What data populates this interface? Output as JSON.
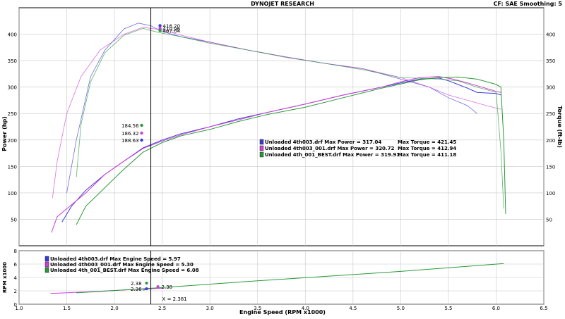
{
  "header": {
    "title": "DYNOJET RESEARCH",
    "settings": "CF: SAE  Smoothing: 5"
  },
  "colors": {
    "run1": "#3b3bd6",
    "run2": "#d040d8",
    "run3": "#2a9a38",
    "axis": "#000000",
    "grid": "#c8c8c8"
  },
  "chart_data": [
    {
      "type": "line",
      "title": "",
      "xlabel": "Engine Speed (RPM x1000)",
      "ylabel": "Power (hp)",
      "ylabel_right": "Torque (ft-lb)",
      "xlim": [
        1.0,
        6.5
      ],
      "ylim": [
        0,
        450
      ],
      "x_ticks": [
        "1.0",
        "1.5",
        "2.0",
        "2.5",
        "3.0",
        "3.5",
        "4.0",
        "4.5",
        "5.0",
        "5.5",
        "6.0",
        "6.5"
      ],
      "y_ticks": [
        "50",
        "100",
        "150",
        "200",
        "250",
        "300",
        "350",
        "400"
      ],
      "grid": true,
      "cursor_x": 2.381,
      "legend": [
        {
          "label": "Unloaded 4th003.drf Max Power = 317.04",
          "torque": "Max Torque = 421.45"
        },
        {
          "label": "Unloaded 4th003_001.drf Max Power = 320.72",
          "torque": "Max Torque = 412.94"
        },
        {
          "label": "Unloaded 4th_001_BEST.drf Max Power = 319.91",
          "torque": "Max Torque = 411.18"
        }
      ],
      "torque_cursor_labels": [
        "416.20",
        "410.96",
        "407.04"
      ],
      "power_cursor_labels": [
        "188.63",
        "186.32",
        "184.56"
      ],
      "series": [
        {
          "name": "4th003 Power",
          "x": [
            1.45,
            1.55,
            1.7,
            1.9,
            2.1,
            2.3,
            2.5,
            2.7,
            3.0,
            3.3,
            3.6,
            4.0,
            4.4,
            4.8,
            5.0,
            5.2,
            5.4,
            5.5,
            5.6,
            5.7,
            5.8,
            6.0,
            6.05
          ],
          "y": [
            45,
            75,
            105,
            135,
            160,
            185,
            200,
            212,
            225,
            240,
            252,
            268,
            285,
            300,
            308,
            315,
            317,
            312,
            305,
            298,
            290,
            288,
            285
          ]
        },
        {
          "name": "4th003_001 Power",
          "x": [
            1.34,
            1.4,
            1.5,
            1.7,
            1.9,
            2.1,
            2.3,
            2.5,
            2.7,
            3.0,
            3.3,
            3.6,
            4.0,
            4.4,
            4.8,
            5.0,
            5.2,
            5.4,
            5.55,
            5.7,
            5.85,
            6.0,
            6.05
          ],
          "y": [
            25,
            55,
            70,
            100,
            135,
            160,
            184,
            198,
            210,
            225,
            238,
            252,
            268,
            285,
            300,
            310,
            318,
            320,
            315,
            308,
            300,
            292,
            290
          ]
        },
        {
          "name": "4th_001_BEST Power",
          "x": [
            1.6,
            1.7,
            1.9,
            2.1,
            2.3,
            2.5,
            2.7,
            3.0,
            3.3,
            3.6,
            4.0,
            4.4,
            4.8,
            5.0,
            5.2,
            5.4,
            5.6,
            5.8,
            6.0,
            6.05,
            6.08,
            6.1
          ],
          "y": [
            40,
            75,
            110,
            145,
            177,
            195,
            208,
            220,
            235,
            248,
            262,
            280,
            298,
            306,
            314,
            318,
            319,
            315,
            305,
            300,
            200,
            60
          ]
        },
        {
          "name": "4th003 Torque",
          "x": [
            1.5,
            1.6,
            1.75,
            1.9,
            2.1,
            2.25,
            2.38,
            2.5,
            2.7,
            3.0,
            3.4,
            3.8,
            4.2,
            4.6,
            5.0,
            5.3,
            5.5,
            5.7,
            5.8
          ],
          "y": [
            100,
            200,
            320,
            370,
            410,
            421,
            416,
            405,
            395,
            385,
            370,
            357,
            345,
            335,
            315,
            300,
            280,
            265,
            250
          ]
        },
        {
          "name": "4th003_001 Torque",
          "x": [
            1.35,
            1.4,
            1.5,
            1.65,
            1.85,
            2.1,
            2.3,
            2.38,
            2.5,
            2.7,
            3.0,
            3.4,
            3.8,
            4.2,
            4.6,
            5.0,
            5.3,
            5.5,
            5.7,
            5.9,
            6.05
          ],
          "y": [
            90,
            160,
            250,
            320,
            370,
            400,
            413,
            411,
            408,
            398,
            385,
            370,
            357,
            345,
            335,
            318,
            300,
            285,
            275,
            265,
            258
          ]
        },
        {
          "name": "4th_001_BEST Torque",
          "x": [
            1.6,
            1.65,
            1.75,
            1.9,
            2.1,
            2.3,
            2.38,
            2.5,
            2.7,
            3.0,
            3.4,
            3.8,
            4.2,
            4.6,
            5.0,
            5.4,
            5.6,
            5.8,
            6.0,
            6.05,
            6.08
          ],
          "y": [
            130,
            230,
            310,
            365,
            398,
            411,
            407,
            402,
            395,
            383,
            370,
            356,
            345,
            333,
            318,
            315,
            312,
            300,
            290,
            180,
            70
          ]
        }
      ]
    },
    {
      "type": "line",
      "title": "",
      "xlabel": "Engine Speed (RPM x1000)",
      "ylabel": "RPM x1000",
      "xlim": [
        1.0,
        6.5
      ],
      "ylim": [
        0,
        8
      ],
      "x_ticks": [
        "1.0",
        "1.5",
        "2.0",
        "2.5",
        "3.0",
        "3.5",
        "4.0",
        "4.5",
        "5.0",
        "5.5",
        "6.0",
        "6.5"
      ],
      "y_ticks": [
        "0",
        "2",
        "4",
        "6",
        "8"
      ],
      "cursor_label": "X = 2.381",
      "cursor_value_labels": [
        "2.38",
        "2.36",
        "2.38"
      ],
      "legend": [
        "Unloaded 4th003.drf Max Engine Speed = 5.97",
        "Unloaded 4th003_001.drf Max Engine Speed = 5.30",
        "Unloaded 4th_001_BEST.drf Max Engine Speed = 6.08"
      ],
      "series": [
        {
          "name": "4th003",
          "x": [
            2.3,
            2.381
          ],
          "y": [
            2.1,
            2.38
          ]
        },
        {
          "name": "4th003_001",
          "x": [
            1.33,
            1.8,
            2.2,
            2.45,
            2.5
          ],
          "y": [
            1.6,
            1.9,
            2.2,
            2.36,
            2.4
          ]
        },
        {
          "name": "4th_001_BEST",
          "x": [
            1.6,
            2.381,
            3.5,
            5.0,
            6.08
          ],
          "y": [
            1.7,
            2.38,
            3.5,
            4.9,
            6.08
          ]
        }
      ]
    }
  ]
}
